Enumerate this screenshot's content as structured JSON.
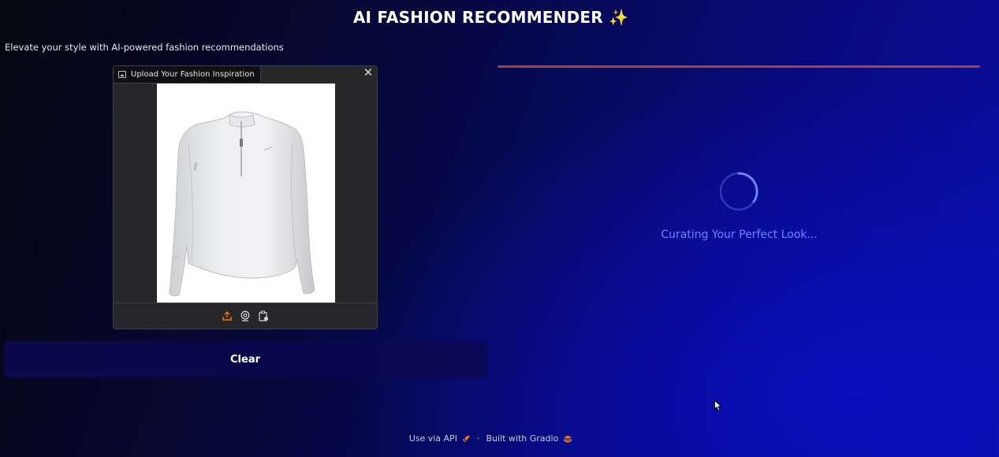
{
  "header": {
    "title": "AI FASHION RECOMMENDER ✨",
    "subtitle": "Elevate your style with AI-powered fashion recommendations"
  },
  "image_input": {
    "label": "Upload Your Fashion Inspiration",
    "close_icon": "close-icon",
    "toolbar": [
      "upload-icon",
      "webcam-icon",
      "clipboard-icon"
    ],
    "accent_color": "#f97316"
  },
  "clear_button": {
    "label": "Clear"
  },
  "output": {
    "loading_text": "Curating Your Perfect Look...",
    "progress_color": "#a0453f",
    "spinner_color": "#6b83ff"
  },
  "footer": {
    "api_label": "Use via API",
    "separator": "·",
    "built_label": "Built with Gradio"
  }
}
